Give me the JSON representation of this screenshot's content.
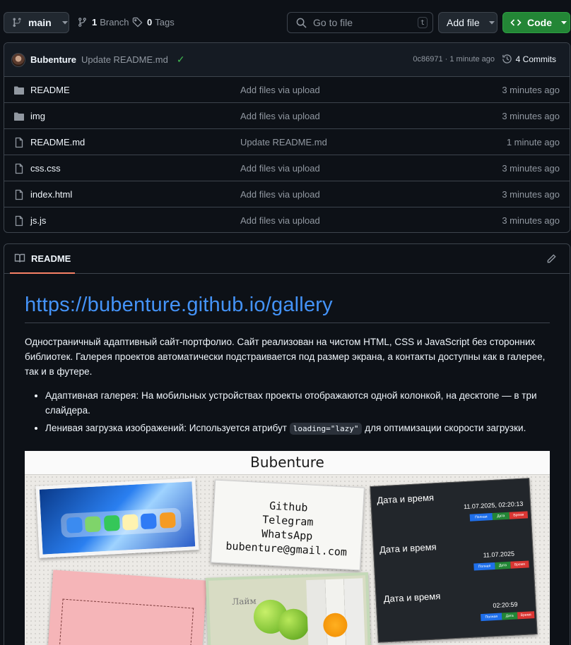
{
  "topbar": {
    "branch": "main",
    "branches_count": "1",
    "branches_label": "Branch",
    "tags_count": "0",
    "tags_label": "Tags",
    "search_placeholder": "Go to file",
    "search_shortcut": "t",
    "add_file_label": "Add file",
    "code_label": "Code"
  },
  "commit": {
    "author": "Bubenture",
    "message": "Update README.md",
    "meta": "0c86971 · 1 minute ago",
    "commits_label": "4 Commits"
  },
  "files": [
    {
      "name": "README",
      "type": "folder",
      "message": "Add files via upload",
      "time": "3 minutes ago"
    },
    {
      "name": "img",
      "type": "folder",
      "message": "Add files via upload",
      "time": "3 minutes ago"
    },
    {
      "name": "README.md",
      "type": "file",
      "message": "Update README.md",
      "time": "1 minute ago"
    },
    {
      "name": "css.css",
      "type": "file",
      "message": "Add files via upload",
      "time": "3 minutes ago"
    },
    {
      "name": "index.html",
      "type": "file",
      "message": "Add files via upload",
      "time": "3 minutes ago"
    },
    {
      "name": "js.js",
      "type": "file",
      "message": "Add files via upload",
      "time": "3 minutes ago"
    }
  ],
  "readme": {
    "tab_label": "README",
    "title": "https://bubenture.github.io/gallery",
    "paragraph": "Одностраничный адаптивный сайт-портфолио. Сайт реализован на чистом HTML, CSS и JavaScript без сторонних библиотек. Галерея проектов автоматически подстраивается под размер экрана, а контакты доступны как в галерее, так и в футере.",
    "bullet1": "Адаптивная галерея: На мобильных устройствах проекты отображаются одной колонкой, на десктопе — в три слайдера.",
    "bullet2_before": "Ленивая загрузка изображений: Используется атрибут ",
    "bullet2_code": "loading=\"lazy\"",
    "bullet2_after": " для оптимизации скорости загрузки."
  },
  "preview": {
    "site_title": "Bubenture",
    "contacts": [
      "Github",
      "Telegram",
      "WhatsApp",
      "bubenture@gmail.com"
    ],
    "datetime_label": "Дата и время",
    "datetime1": "11.07.2025, 02:20:13",
    "date2": "11.07.2025",
    "time3": "02:20:59",
    "pill_full": "Полная",
    "pill_date": "Дата",
    "pill_time": "Время",
    "lime_label": "Лайм"
  },
  "colors": {
    "accent_blue": "#4493f8",
    "code_green": "#238636",
    "tab_underline": "#f78166",
    "check_green": "#3fb950"
  },
  "icons": {
    "branch": "git-branch-icon",
    "tag": "tag-icon",
    "search": "search-icon",
    "code": "code-icon",
    "history": "history-icon",
    "folder": "folder-icon",
    "file": "file-icon",
    "book": "book-icon",
    "pencil": "pencil-icon"
  }
}
